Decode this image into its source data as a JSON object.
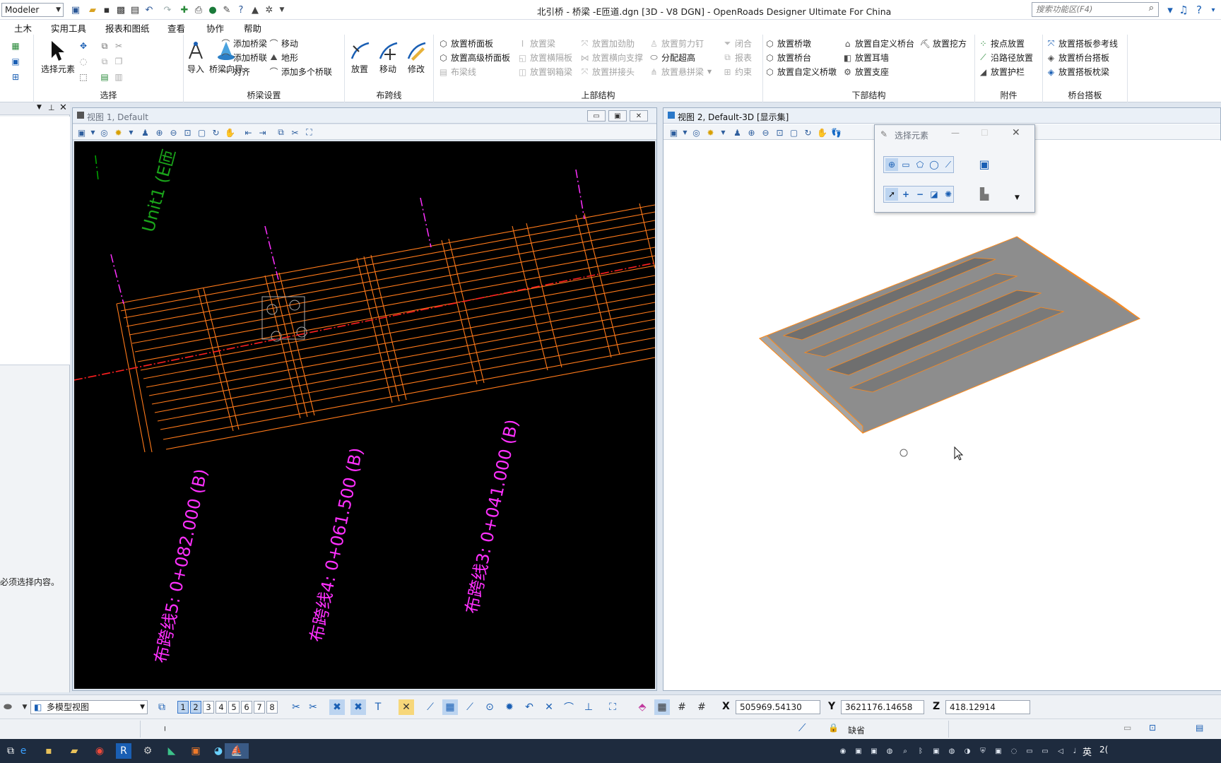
{
  "app": {
    "workspace": "Modeler",
    "window_title": "北引桥 - 桥梁 -E匝道.dgn [3D - V8 DGN] - OpenRoads Designer Ultimate For China",
    "search_placeholder": "搜索功能区(F4)"
  },
  "menu": {
    "items": [
      "土木",
      "实用工具",
      "报表和图纸",
      "查看",
      "协作",
      "帮助"
    ]
  },
  "ribbon": {
    "select": {
      "label": "选择",
      "big": "选择元素"
    },
    "bridge_setup": {
      "label": "桥梁设置",
      "import": "导入",
      "wizard": "桥梁向导",
      "add_bridge": "添加桥梁",
      "add_unit": "添加桥联",
      "align": "对齐",
      "move": "移动",
      "terrain": "地形",
      "add_multi": "添加多个桥联"
    },
    "span": {
      "label": "布跨线",
      "place": "放置",
      "move": "移动",
      "modify": "修改"
    },
    "super": {
      "label": "上部结构",
      "deck": "放置桥面板",
      "adv_deck": "放置高级桥面板",
      "span_line": "布梁线",
      "beam": "放置梁",
      "diaphragm": "放置横隔板",
      "steel_box": "放置钢箱梁",
      "stiffener": "放置加劲肋",
      "cross_brace": "放置横向支撑",
      "splice": "放置拼接头",
      "shear_stud": "放置剪力钉",
      "superelev": "分配超高",
      "segment": "放置悬拼梁",
      "close": "闭合",
      "report": "报表",
      "constraint": "约束"
    },
    "sub": {
      "label": "下部结构",
      "pier": "放置桥墩",
      "abutment": "放置桥台",
      "custom_pier": "放置自定义桥墩",
      "custom_abut": "放置自定义桥台",
      "ear_wall": "放置耳墙",
      "bearing": "放置支座",
      "excavation": "放置挖方"
    },
    "attach": {
      "label": "附件",
      "point": "按点放置",
      "path": "沿路径放置",
      "barrier": "放置护栏"
    },
    "approach": {
      "label": "桥台搭板",
      "ref_line": "放置搭板参考线",
      "slab": "放置桥台搭板",
      "sleeper": "放置搭板枕梁"
    }
  },
  "leftpanel": {
    "message": "必须选择内容。"
  },
  "view1": {
    "title": "视图 1, Default",
    "unit_label": "Unit1 (E匝",
    "span_lines": [
      "布跨线5: 0+082.000 (B)",
      "布跨线4: 0+061.500 (B)",
      "布跨线3: 0+041.000 (B)"
    ]
  },
  "view2": {
    "title": "视图 2, Default-3D [显示集]"
  },
  "select_panel": {
    "title": "选择元素"
  },
  "bottom": {
    "view_mode": "多模型视图",
    "view_numbers": [
      "1",
      "2",
      "3",
      "4",
      "5",
      "6",
      "7",
      "8"
    ],
    "x_label": "X",
    "x": "505969.54130",
    "y_label": "Y",
    "y": "3621176.14658",
    "z_label": "Z",
    "z": "418.12914"
  },
  "status": {
    "level": "缺省"
  },
  "taskbar": {
    "ime": "英",
    "clock_partial": "2("
  }
}
